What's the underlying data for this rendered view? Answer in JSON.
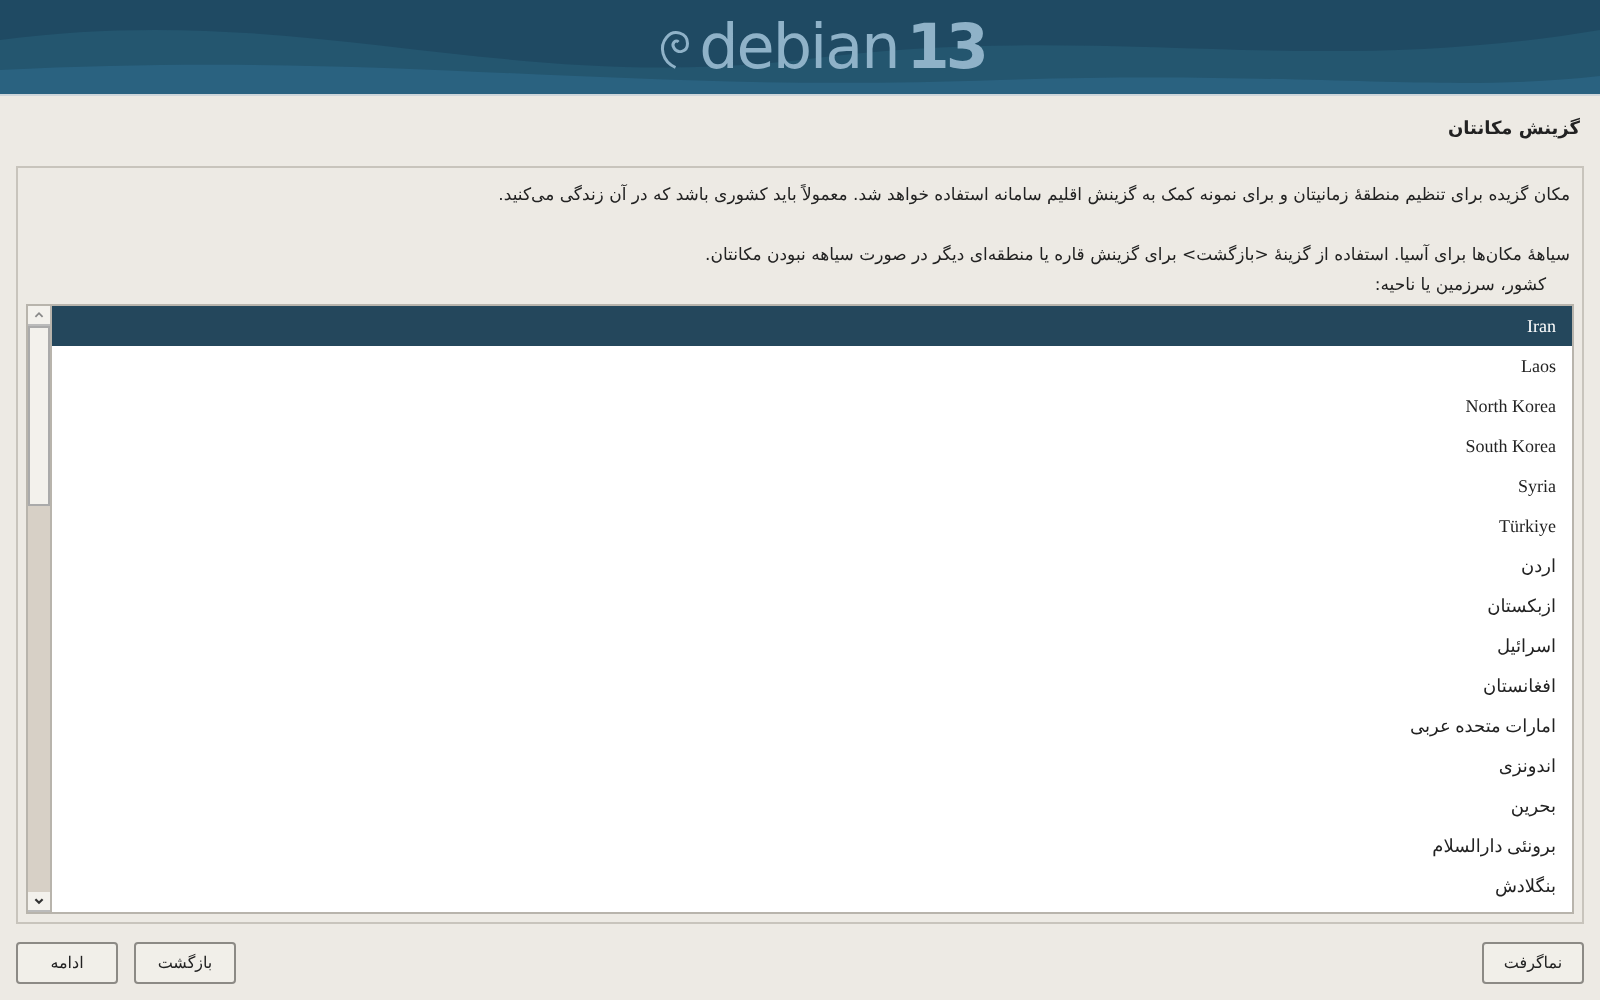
{
  "banner": {
    "name": "debian",
    "version": "13"
  },
  "title": "گزینش مکانتان",
  "paragraphs": [
    "مکان گزیده برای تنظیم منطقهٔ زمانیتان و برای نمونه کمک به گزینش اقلیم سامانه استفاده خواهد شد. معمولاً باید کشوری باشد که در آن زندگی می‌کنید.",
    "سیاههٔ مکان‌ها برای آسیا. استفاده از گزینهٔ <بازگشت> برای گزینش قاره یا منطقه‌ای دیگر در صورت سیاهه نبودن مکانتان."
  ],
  "list_label": "کشور، سرزمین یا ناحیه:",
  "countries": [
    {
      "name": "Iran",
      "selected": true
    },
    {
      "name": "Laos",
      "selected": false
    },
    {
      "name": "North Korea",
      "selected": false
    },
    {
      "name": "South Korea",
      "selected": false
    },
    {
      "name": "Syria",
      "selected": false
    },
    {
      "name": "Türkiye",
      "selected": false
    },
    {
      "name": "اردن",
      "selected": false
    },
    {
      "name": "ازبکستان",
      "selected": false
    },
    {
      "name": "اسرائیل",
      "selected": false
    },
    {
      "name": "افغانستان",
      "selected": false
    },
    {
      "name": "امارات متحده عربی",
      "selected": false
    },
    {
      "name": "اندونزی",
      "selected": false
    },
    {
      "name": "بحرین",
      "selected": false
    },
    {
      "name": "برونئی دارالسلام",
      "selected": false
    },
    {
      "name": "بنگلادش",
      "selected": false
    }
  ],
  "buttons": {
    "screenshot": "نماگرفت",
    "back": "بازگشت",
    "continue": "ادامه"
  }
}
